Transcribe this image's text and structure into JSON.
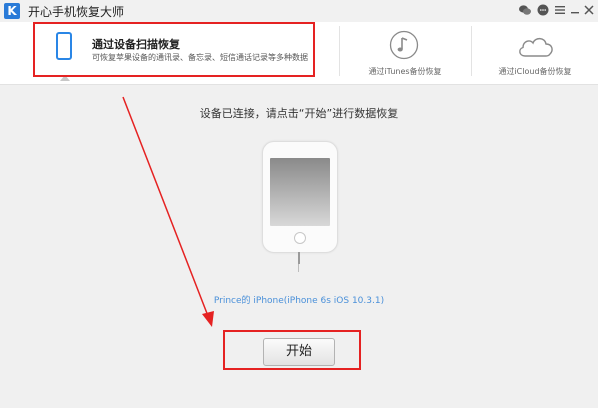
{
  "window": {
    "title": "开心手机恢复大师",
    "logo_letter": "K",
    "controls": [
      "wechat-icon",
      "chat-icon",
      "menu-icon",
      "minimize-icon",
      "close-icon"
    ]
  },
  "tabs": [
    {
      "title": "通过设备扫描恢复",
      "description": "可恢复苹果设备的通讯录、备忘录、短信通话记录等多种数据",
      "icon": "phone-icon",
      "selected": true
    },
    {
      "label": "通过iTunes备份恢复",
      "icon": "music-note-icon"
    },
    {
      "label": "通过iCloud备份恢复",
      "icon": "cloud-icon"
    }
  ],
  "main": {
    "status": "设备已连接，请点击“开始”进行数据恢复",
    "device_label": "Prince的 iPhone(iPhone 6s iOS 10.3.1)",
    "start_label": "开始"
  },
  "colors": {
    "accent": "#2a86e6",
    "annotation": "#e52222",
    "link": "#4a90d9"
  }
}
